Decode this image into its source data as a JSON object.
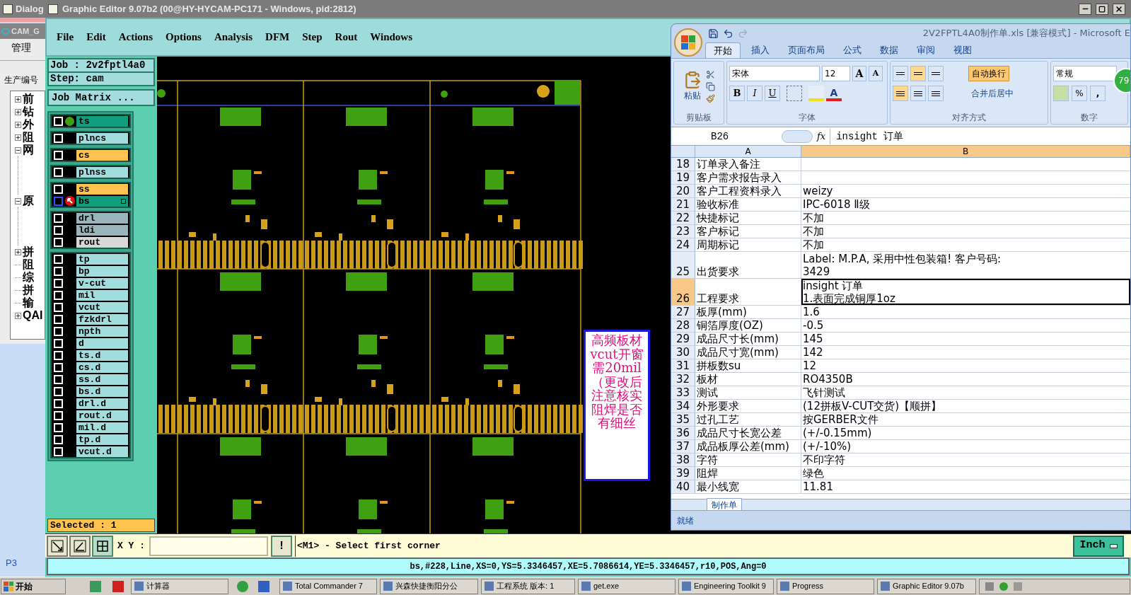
{
  "background_window": {
    "title": "Dialog",
    "subtitle": "CAM_G",
    "menu": "管理",
    "field_label": "生产编号",
    "tree": [
      {
        "label": "前",
        "kind": "folder",
        "expanded": false
      },
      {
        "label": "钻",
        "kind": "folder",
        "expanded": false
      },
      {
        "label": "外",
        "kind": "folder",
        "expanded": false
      },
      {
        "label": "阻",
        "kind": "folder",
        "expanded": false
      },
      {
        "label": "网",
        "kind": "folder",
        "expanded": true
      },
      {
        "label": "原",
        "kind": "folder",
        "expanded": true
      },
      {
        "label": "拼",
        "kind": "folder",
        "expanded": false
      },
      {
        "label": "阻",
        "kind": "leaf"
      },
      {
        "label": "综",
        "kind": "leaf"
      },
      {
        "label": "拼",
        "kind": "leaf"
      },
      {
        "label": "输",
        "kind": "leaf"
      },
      {
        "label": "QAI",
        "kind": "folder",
        "expanded": false
      }
    ],
    "footer": "P3"
  },
  "editor": {
    "title": "Graphic Editor 9.07b2 (00@HY-HYCAM-PC171 - Windows, pid:2812)",
    "menu": [
      "File",
      "Edit",
      "Actions",
      "Options",
      "Analysis",
      "DFM",
      "Step",
      "Rout",
      "Windows"
    ],
    "job": "Job : 2v2fptl4a0",
    "step": "Step: cam",
    "job_matrix_button": "Job Matrix ...",
    "layer_groups": [
      {
        "layers": [
          {
            "name": "ts",
            "color": "#119e7c",
            "checked": false,
            "displayed": true,
            "work": false
          }
        ]
      },
      {
        "layers": [
          {
            "name": "plncs",
            "color": "#a3dcdc",
            "checked": false,
            "displayed": false,
            "work": false
          }
        ]
      },
      {
        "layers": [
          {
            "name": "cs",
            "color": "#ffc34f",
            "checked": false,
            "displayed": false,
            "work": false
          }
        ]
      },
      {
        "layers": [
          {
            "name": "plnss",
            "color": "#a3dcdc",
            "checked": false,
            "displayed": false,
            "work": false
          }
        ]
      },
      {
        "layers": [
          {
            "name": "ss",
            "color": "#ffc34f",
            "checked": false,
            "displayed": false,
            "work": false
          },
          {
            "name": "bs",
            "color": "#119e7c",
            "checked": false,
            "displayed": false,
            "work": true
          }
        ]
      },
      {
        "layers": [
          {
            "name": "drl",
            "color": "#9ab4bc",
            "checked": false,
            "displayed": false,
            "work": false
          },
          {
            "name": "ldi",
            "color": "#9ab4bc",
            "checked": false,
            "displayed": false,
            "work": false
          },
          {
            "name": "rout",
            "color": "#d8d8d8",
            "checked": false,
            "displayed": false,
            "work": false
          }
        ]
      },
      {
        "layers": [
          {
            "name": "tp",
            "color": "#a3dcdc",
            "checked": false,
            "displayed": false,
            "work": false
          },
          {
            "name": "bp",
            "color": "#a3dcdc",
            "checked": false,
            "displayed": false,
            "work": false
          },
          {
            "name": "v-cut",
            "color": "#a3dcdc",
            "checked": false,
            "displayed": false,
            "work": false
          },
          {
            "name": "mil",
            "color": "#a3dcdc",
            "checked": false,
            "displayed": false,
            "work": false
          },
          {
            "name": "vcut",
            "color": "#a3dcdc",
            "checked": false,
            "displayed": false,
            "work": false
          },
          {
            "name": "fzkdrl",
            "color": "#a3dcdc",
            "checked": false,
            "displayed": false,
            "work": false
          },
          {
            "name": "npth",
            "color": "#a3dcdc",
            "checked": false,
            "displayed": false,
            "work": false
          },
          {
            "name": "d",
            "color": "#a3dcdc",
            "checked": false,
            "displayed": false,
            "work": false
          },
          {
            "name": "ts.d",
            "color": "#a3dcdc",
            "checked": false,
            "displayed": false,
            "work": false
          },
          {
            "name": "cs.d",
            "color": "#a3dcdc",
            "checked": false,
            "displayed": false,
            "work": false
          },
          {
            "name": "ss.d",
            "color": "#a3dcdc",
            "checked": false,
            "displayed": false,
            "work": false
          },
          {
            "name": "bs.d",
            "color": "#a3dcdc",
            "checked": false,
            "displayed": false,
            "work": false
          },
          {
            "name": "drl.d",
            "color": "#a3dcdc",
            "checked": false,
            "displayed": false,
            "work": false
          },
          {
            "name": "rout.d",
            "color": "#a3dcdc",
            "checked": false,
            "displayed": false,
            "work": false
          },
          {
            "name": "mil.d",
            "color": "#a3dcdc",
            "checked": false,
            "displayed": false,
            "work": false
          },
          {
            "name": "tp.d",
            "color": "#a3dcdc",
            "checked": false,
            "displayed": false,
            "work": false
          },
          {
            "name": "vcut.d",
            "color": "#a3dcdc",
            "checked": false,
            "displayed": false,
            "work": false
          }
        ]
      }
    ],
    "selected_count": "Selected : 1",
    "xy_label": "X Y :",
    "prompt_button": "!",
    "message": "<M1> - Select first corner",
    "units": "Inch",
    "status": "bs,#228,Line,XS=0,YS=5.3346457,XE=5.7086614,YE=5.3346457,r10,POS,Ang=0",
    "note": "高频板材vcut开窗需20mil（更改后注意核实阻焊是否有细丝"
  },
  "excel": {
    "title": "2V2FPTL4A0制作单.xls  [兼容模式] - Microsoft E",
    "badge": "79",
    "ribbon_tabs": [
      {
        "label": "开始",
        "selected": true
      },
      {
        "label": "插入",
        "selected": false
      },
      {
        "label": "页面布局",
        "selected": false
      },
      {
        "label": "公式",
        "selected": false
      },
      {
        "label": "数据",
        "selected": false
      },
      {
        "label": "审阅",
        "selected": false
      },
      {
        "label": "视图",
        "selected": false
      }
    ],
    "clipboard": {
      "paste": "粘贴",
      "group": "剪贴板"
    },
    "font": {
      "name": "宋体",
      "size": "12",
      "grow": "A",
      "shrink": "A",
      "styles": [
        "B",
        "I",
        "U"
      ],
      "color_button": "A",
      "group": "字体"
    },
    "alignment": {
      "wrap": {
        "label": "自动换行",
        "on": true
      },
      "merge": "合并后居中",
      "group": "对齐方式"
    },
    "number": {
      "format": "常规",
      "percent": "%",
      "comma": ",",
      "group": "数字"
    },
    "name_box": "B26",
    "fx": "fx",
    "formula": "insight 订单",
    "columns": [
      {
        "label": "A",
        "selected": false
      },
      {
        "label": "B",
        "selected": true
      }
    ],
    "rows": [
      {
        "n": "18",
        "a": "订单录入备注",
        "selected": false
      },
      {
        "n": "19",
        "a": "客户需求报告录入",
        "selected": false
      },
      {
        "n": "20",
        "a": "客户工程资料录入",
        "b": "weizy",
        "selected": false
      },
      {
        "n": "21",
        "a": "验收标准",
        "b": "IPC-6018 Ⅱ级",
        "selected": false
      },
      {
        "n": "22",
        "a": "快捷标记",
        "b": "不加",
        "selected": false
      },
      {
        "n": "23",
        "a": "客户标记",
        "b": "不加",
        "selected": false
      },
      {
        "n": "24",
        "a": "周期标记",
        "b": "不加",
        "selected": false
      },
      {
        "n": "25",
        "a": "出货要求",
        "b_lines": [
          "Label: M.P.A, 采用中性包装箱! 客户号码:",
          "3429"
        ],
        "selected": false
      },
      {
        "n": "26",
        "a": "工程要求",
        "b_lines": [
          "insight 订单",
          "1.表面完成铜厚1oz"
        ],
        "selected": true
      },
      {
        "n": "27",
        "a": "板厚(mm)",
        "b": "1.6",
        "selected": false
      },
      {
        "n": "28",
        "a": "铜箔厚度(OZ)",
        "b": "-0.5",
        "selected": false
      },
      {
        "n": "29",
        "a": "成品尺寸长(mm)",
        "b": "145",
        "selected": false
      },
      {
        "n": "30",
        "a": "成品尺寸宽(mm)",
        "b": "142",
        "selected": false
      },
      {
        "n": "31",
        "a": "拼板数su",
        "b": "12",
        "selected": false
      },
      {
        "n": "32",
        "a": "板材",
        "b": "RO4350B",
        "selected": false
      },
      {
        "n": "33",
        "a": "测试",
        "b": "飞针测试",
        "selected": false
      },
      {
        "n": "34",
        "a": "外形要求",
        "b": "(12拼板V-CUT交货)【顺拼】",
        "selected": false
      },
      {
        "n": "35",
        "a": "过孔工艺",
        "b": "按GERBER文件",
        "selected": false
      },
      {
        "n": "36",
        "a": "成品尺寸长宽公差",
        "b": "(+/-0.15mm)",
        "selected": false
      },
      {
        "n": "37",
        "a": "成品板厚公差(mm)",
        "b": "(+/-10%)",
        "selected": false
      },
      {
        "n": "38",
        "a": "字符",
        "b": "不印字符",
        "selected": false
      },
      {
        "n": "39",
        "a": "阻焊",
        "b": "绿色",
        "selected": false
      },
      {
        "n": "40",
        "a": "最小线宽",
        "b": "11.81",
        "selected": false
      }
    ],
    "sheet_tab": "制作单",
    "status": "就绪"
  },
  "taskbar": {
    "start": "开始",
    "items": [
      "计算器",
      "Total Commander 7",
      "兴森快捷衡阳分公",
      "工程系统  版本: 1",
      "get.exe",
      "Engineering Toolkit 9",
      "Progress",
      "Graphic Editor 9.07b"
    ]
  }
}
